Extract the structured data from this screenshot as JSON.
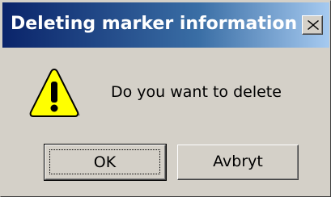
{
  "window": {
    "title": "Deleting marker information",
    "close_icon": "close-icon"
  },
  "dialog": {
    "icon": "warning-icon",
    "message": "Do you want to delete"
  },
  "buttons": {
    "ok_label": "OK",
    "cancel_label": "Avbryt"
  },
  "colors": {
    "titlebar_start": "#0a246a",
    "titlebar_end": "#a6caf0",
    "face": "#d4d0c8",
    "warning_fill": "#ffff00"
  }
}
